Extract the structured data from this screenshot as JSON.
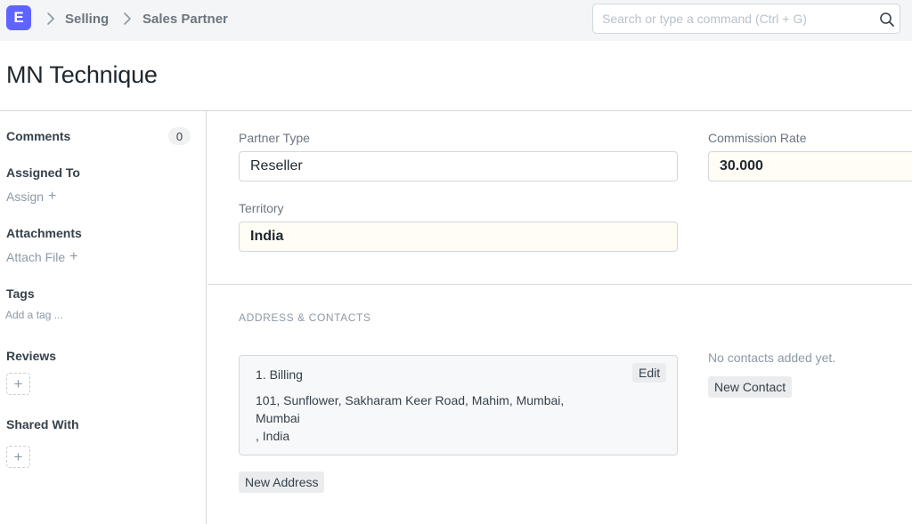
{
  "app": {
    "logo_letter": "E",
    "brand_color": "#5e64ff"
  },
  "breadcrumb": {
    "items": [
      "Selling",
      "Sales Partner"
    ]
  },
  "search": {
    "placeholder": "Search or type a command (Ctrl + G)",
    "value": ""
  },
  "page": {
    "title": "MN Technique"
  },
  "sidebar": {
    "comments_label": "Comments",
    "comments_count": "0",
    "assigned_label": "Assigned To",
    "assign_link": "Assign",
    "attachments_label": "Attachments",
    "attach_link": "Attach File",
    "tags_label": "Tags",
    "add_tag": "Add a tag ...",
    "reviews_label": "Reviews",
    "shared_label": "Shared With",
    "add_glyph": "+"
  },
  "form": {
    "partner_type_label": "Partner Type",
    "partner_type_value": "Reseller",
    "commission_rate_label": "Commission Rate",
    "commission_rate_value": "30.000",
    "territory_label": "Territory",
    "territory_value": "India"
  },
  "address_contacts": {
    "section_title": "ADDRESS & CONTACTS",
    "address": {
      "title": "1. Billing",
      "edit_label": "Edit",
      "line1": "101, Sunflower, Sakharam Keer Road, Mahim, Mumbai,",
      "line2": "Mumbai",
      "line3": ", India"
    },
    "new_address_label": "New Address",
    "no_contacts_text": "No contacts added yet.",
    "new_contact_label": "New Contact"
  }
}
